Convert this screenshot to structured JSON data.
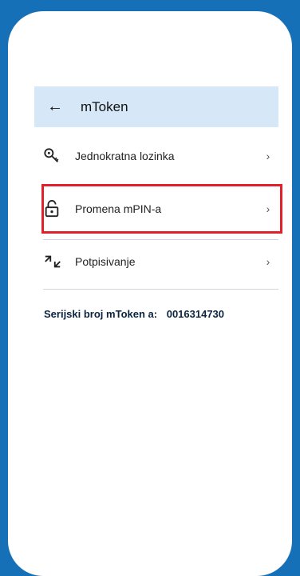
{
  "header": {
    "title": "mToken"
  },
  "menu": [
    {
      "label": "Jednokratna lozinka",
      "icon": "key-icon"
    },
    {
      "label": "Promena mPIN-a",
      "icon": "unlock-icon"
    },
    {
      "label": "Potpisivanje",
      "icon": "sign-arrows-icon"
    }
  ],
  "serial": {
    "label": "Serijski broj mToken a:",
    "value": "0016314730"
  },
  "colors": {
    "background": "#1570b8",
    "header": "#d6e7f8",
    "highlight": "#e0212b"
  }
}
